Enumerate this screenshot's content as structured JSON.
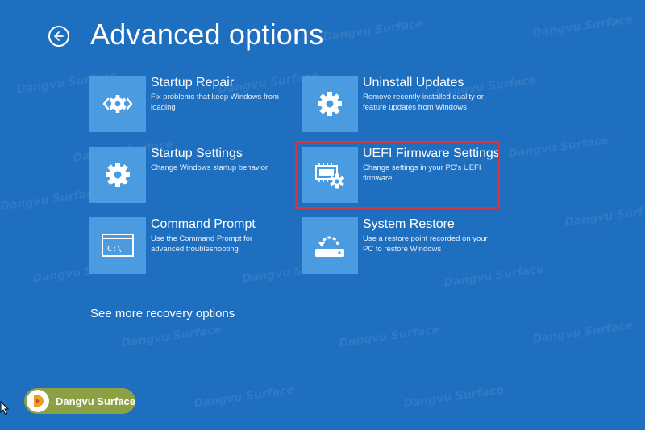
{
  "page": {
    "title": "Advanced options",
    "back_label": "Back"
  },
  "options": [
    {
      "id": "startup-repair",
      "icon": "startup-repair-icon",
      "label": "Startup Repair",
      "description": "Fix problems that keep Windows from loading"
    },
    {
      "id": "uninstall-updates",
      "icon": "gear-icon",
      "label": "Uninstall Updates",
      "description": "Remove recently installed quality or feature updates from Windows"
    },
    {
      "id": "startup-settings",
      "icon": "gear-icon",
      "label": "Startup Settings",
      "description": "Change Windows startup behavior"
    },
    {
      "id": "uefi-firmware-settings",
      "icon": "firmware-chip-gear-icon",
      "label": "UEFI Firmware Settings",
      "description": "Change settings in your PC's UEFI firmware",
      "highlighted": true
    },
    {
      "id": "command-prompt",
      "icon": "command-prompt-icon",
      "label": "Command Prompt",
      "description": "Use the Command Prompt for advanced troubleshooting"
    },
    {
      "id": "system-restore",
      "icon": "system-restore-icon",
      "label": "System Restore",
      "description": "Use a restore point recorded on your PC to restore Windows"
    }
  ],
  "more_link": "See more recovery options",
  "watermark": {
    "brand": "Dangvu Surface"
  },
  "colors": {
    "background": "#1f6fc0",
    "tile": "#4a9be0",
    "highlight": "#d9343b",
    "badge": "#8da044"
  }
}
